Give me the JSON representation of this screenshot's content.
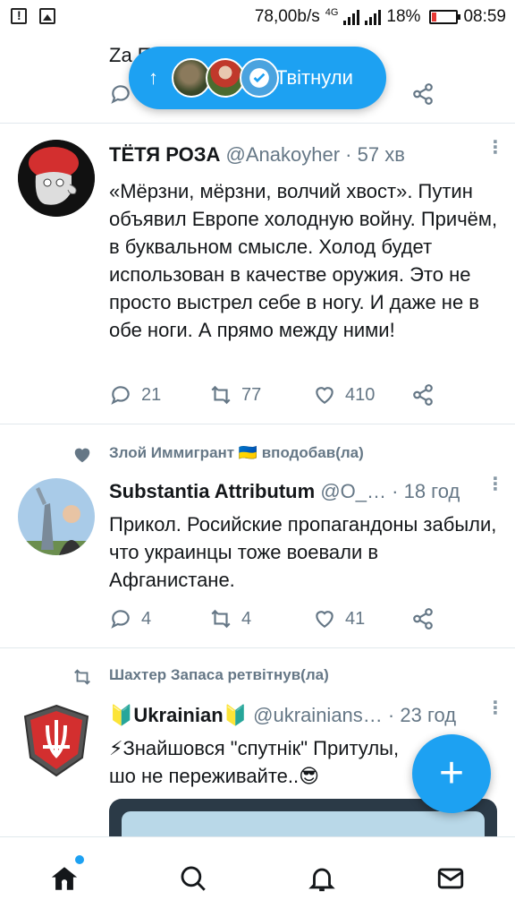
{
  "status_bar": {
    "speed": "78,00b/s",
    "network": "4G",
    "battery": "18%",
    "time": "08:59"
  },
  "pill": {
    "label": "Твітнули"
  },
  "prev_tweet": {
    "text_fragment": "Za П"
  },
  "tweets": [
    {
      "name": "ТЁТЯ РОЗА",
      "handle": "@Anakoyher",
      "separator": "·",
      "time": "57 хв",
      "text": "«Мёрзни, мёрзни, волчий хвост». Путин объявил Европе холодную войну. Причём, в буквальном смысле. Холод будет использован в качестве оружия. Это не просто выстрел себе в ногу. И даже не в обе ноги. А прямо между ними!",
      "replies": "21",
      "retweets": "77",
      "likes": "410"
    },
    {
      "context": "Злой Иммигрант 🇺🇦 вподобав(ла)",
      "name": "Substantia Attributum",
      "handle": "@О_…",
      "separator": "·",
      "time": "18 год",
      "text": "Прикол. Росийские пропагандоны забыли, что украинцы тоже воевали в Афганистане.",
      "replies": "4",
      "retweets": "4",
      "likes": "41"
    },
    {
      "context": "Шахтер Запаса ретвітнув(ла)",
      "name": "🔰Ukrainian🔰",
      "handle": "@ukrainians…",
      "separator": "·",
      "time": "23 год",
      "text": "⚡Знайшовся \"спутнік\" Притулы, шо не переживайте..😎"
    }
  ],
  "nav": {
    "items": [
      "home-icon",
      "search-icon",
      "notifications-icon",
      "messages-icon"
    ]
  },
  "colors": {
    "accent": "#1da1f2",
    "muted": "#657786",
    "text": "#14171a"
  }
}
